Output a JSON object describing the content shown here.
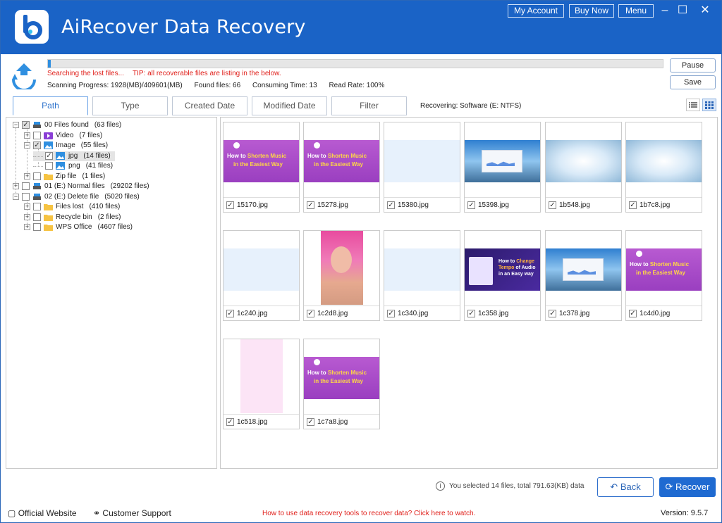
{
  "app": {
    "title": "AiRecover Data Recovery",
    "my_account": "My Account",
    "buy_now": "Buy Now",
    "menu": "Menu"
  },
  "scan": {
    "status": "Searching the lost files...",
    "tip": "TIP: all recoverable files are listing in the below.",
    "progress_label": "Scanning Progress: 1928(MB)/409601(MB)",
    "found": "Found files: 66",
    "time": "Consuming Time: 13",
    "read_rate": "Read Rate: 100%",
    "progress_fraction": 0.0047,
    "pause": "Pause",
    "save": "Save"
  },
  "tabs": [
    "Path",
    "Type",
    "Created Date",
    "Modified Date",
    "Filter"
  ],
  "active_tab": "Path",
  "recovering": "Recovering: Software (E: NTFS)",
  "tree": {
    "root": {
      "label": "00 Files found",
      "count": "(63 files)"
    },
    "video": {
      "label": "Video",
      "count": "(7 files)"
    },
    "image": {
      "label": "Image",
      "count": "(55 files)"
    },
    "jpg": {
      "label": "jpg",
      "count": "(14 files)"
    },
    "png": {
      "label": "png",
      "count": "(41 files)"
    },
    "zip": {
      "label": "Zip file",
      "count": "(1 files)"
    },
    "normal": {
      "label": "01 (E:) Normal files",
      "count": "(29202 files)"
    },
    "deleted": {
      "label": "02 (E:) Delete file",
      "count": "(5020 files)"
    },
    "lost": {
      "label": "Files lost",
      "count": "(410 files)"
    },
    "recycle": {
      "label": "Recycle bin",
      "count": "(2 files)"
    },
    "wps": {
      "label": "WPS Office",
      "count": "(4607 files)"
    }
  },
  "files": [
    {
      "name": "15170.jpg",
      "kind": "banner"
    },
    {
      "name": "15278.jpg",
      "kind": "banner"
    },
    {
      "name": "15380.jpg",
      "kind": "pale"
    },
    {
      "name": "15398.jpg",
      "kind": "sky"
    },
    {
      "name": "1b548.jpg",
      "kind": "glow"
    },
    {
      "name": "1b7c8.jpg",
      "kind": "glow"
    },
    {
      "name": "1c240.jpg",
      "kind": "pale"
    },
    {
      "name": "1c2d8.jpg",
      "kind": "girl"
    },
    {
      "name": "1c340.jpg",
      "kind": "pale"
    },
    {
      "name": "1c358.jpg",
      "kind": "tempo"
    },
    {
      "name": "1c378.jpg",
      "kind": "sky"
    },
    {
      "name": "1c4d0.jpg",
      "kind": "banner"
    },
    {
      "name": "1c518.jpg",
      "kind": "pink"
    },
    {
      "name": "1c7a8.jpg",
      "kind": "banner"
    }
  ],
  "banner_text": {
    "how_to": "How to",
    "shorten": "Shorten Music",
    "easiest": "in the Easiest Way"
  },
  "tempo_text": {
    "line1": "How to",
    "change": "Change",
    "line2": "Tempo",
    "line2b": "of Audio",
    "line3": "in an Easy way"
  },
  "footer": {
    "selection": "You selected 14 files, total 791.63(KB) data",
    "back": "Back",
    "recover": "Recover",
    "official": "Official Website",
    "support": "Customer Support",
    "help": "How to use data recovery tools to recover data? Click here to watch.",
    "version": "Version: 9.5.7"
  },
  "colors": {
    "title_bar": "#1a63c6",
    "accent": "#1f6ad1",
    "alert": "#e0201b"
  }
}
